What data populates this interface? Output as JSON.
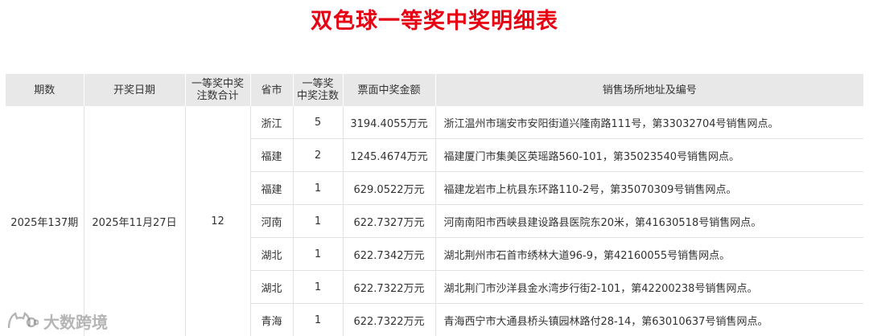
{
  "title": "双色球一等奖中奖明细表",
  "columns": [
    "期数",
    "开奖日期",
    "一等奖中奖\n注数合计",
    "省市",
    "一等奖\n中奖注数",
    "票面中奖金额",
    "销售场所地址及编号"
  ],
  "draw": {
    "period": "2025年137期",
    "date": "2025年11月27日",
    "total": "12"
  },
  "rows": [
    {
      "province": "浙江",
      "count": "5",
      "amount": "3194.4055万元",
      "address": "浙江温州市瑞安市安阳街道兴隆南路111号，第33032704号销售网点。"
    },
    {
      "province": "福建",
      "count": "2",
      "amount": "1245.4674万元",
      "address": "福建厦门市集美区英瑶路560-101，第35023540号销售网点。"
    },
    {
      "province": "福建",
      "count": "1",
      "amount": "629.0522万元",
      "address": "福建龙岩市上杭县东环路110-2号，第35070309号销售网点。"
    },
    {
      "province": "河南",
      "count": "1",
      "amount": "622.7327万元",
      "address": "河南南阳市西峡县建设路县医院东20米，第41630518号销售网点。"
    },
    {
      "province": "湖北",
      "count": "1",
      "amount": "622.7342万元",
      "address": "湖北荆州市石首市绣林大道96-9，第42160055号销售网点。"
    },
    {
      "province": "湖北",
      "count": "1",
      "amount": "622.7322万元",
      "address": "湖北荆门市沙洋县金水湾步行街2-101，第42200238号销售网点。"
    },
    {
      "province": "青海",
      "count": "1",
      "amount": "622.7322万元",
      "address": "青海西宁市大通县桥头镇园林路付28-14，第63010637号销售网点。"
    }
  ],
  "watermark": {
    "text": "大数跨境",
    "icon": "cat-logo-icon"
  },
  "colors": {
    "title": "#e60012",
    "header_bg": "#e8e8e8"
  }
}
